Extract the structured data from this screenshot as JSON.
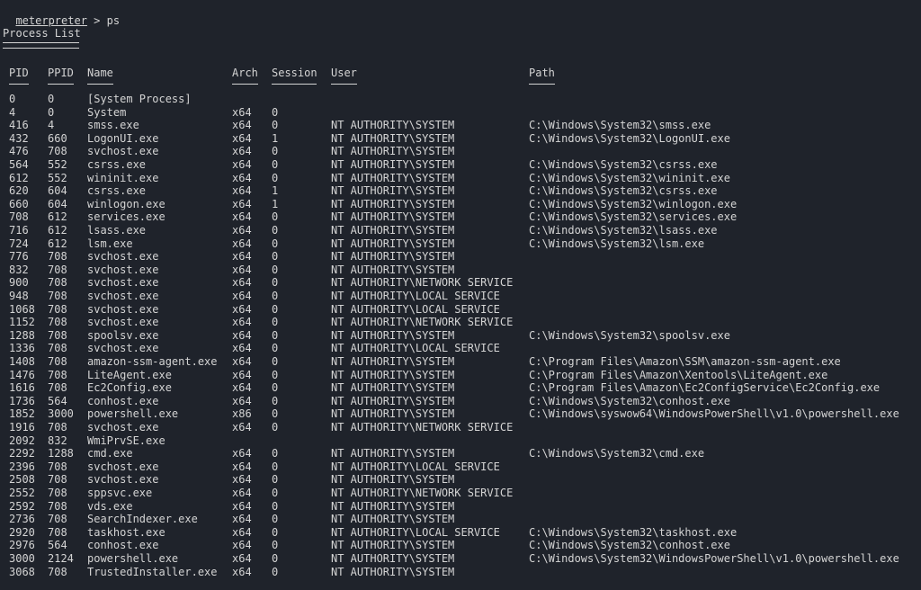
{
  "prompt": {
    "name": "meterpreter",
    "symbol": " > ",
    "command": "ps"
  },
  "title": "Process List",
  "columns": [
    "PID",
    "PPID",
    "Name",
    "Arch",
    "Session",
    "User",
    "Path"
  ],
  "rows": [
    [
      "0",
      "0",
      "[System Process]",
      "",
      "",
      "",
      ""
    ],
    [
      "4",
      "0",
      "System",
      "x64",
      "0",
      "",
      ""
    ],
    [
      "416",
      "4",
      "smss.exe",
      "x64",
      "0",
      "NT AUTHORITY\\SYSTEM",
      "C:\\Windows\\System32\\smss.exe"
    ],
    [
      "432",
      "660",
      "LogonUI.exe",
      "x64",
      "1",
      "NT AUTHORITY\\SYSTEM",
      "C:\\Windows\\System32\\LogonUI.exe"
    ],
    [
      "476",
      "708",
      "svchost.exe",
      "x64",
      "0",
      "NT AUTHORITY\\SYSTEM",
      ""
    ],
    [
      "564",
      "552",
      "csrss.exe",
      "x64",
      "0",
      "NT AUTHORITY\\SYSTEM",
      "C:\\Windows\\System32\\csrss.exe"
    ],
    [
      "612",
      "552",
      "wininit.exe",
      "x64",
      "0",
      "NT AUTHORITY\\SYSTEM",
      "C:\\Windows\\System32\\wininit.exe"
    ],
    [
      "620",
      "604",
      "csrss.exe",
      "x64",
      "1",
      "NT AUTHORITY\\SYSTEM",
      "C:\\Windows\\System32\\csrss.exe"
    ],
    [
      "660",
      "604",
      "winlogon.exe",
      "x64",
      "1",
      "NT AUTHORITY\\SYSTEM",
      "C:\\Windows\\System32\\winlogon.exe"
    ],
    [
      "708",
      "612",
      "services.exe",
      "x64",
      "0",
      "NT AUTHORITY\\SYSTEM",
      "C:\\Windows\\System32\\services.exe"
    ],
    [
      "716",
      "612",
      "lsass.exe",
      "x64",
      "0",
      "NT AUTHORITY\\SYSTEM",
      "C:\\Windows\\System32\\lsass.exe"
    ],
    [
      "724",
      "612",
      "lsm.exe",
      "x64",
      "0",
      "NT AUTHORITY\\SYSTEM",
      "C:\\Windows\\System32\\lsm.exe"
    ],
    [
      "776",
      "708",
      "svchost.exe",
      "x64",
      "0",
      "NT AUTHORITY\\SYSTEM",
      ""
    ],
    [
      "832",
      "708",
      "svchost.exe",
      "x64",
      "0",
      "NT AUTHORITY\\SYSTEM",
      ""
    ],
    [
      "900",
      "708",
      "svchost.exe",
      "x64",
      "0",
      "NT AUTHORITY\\NETWORK SERVICE",
      ""
    ],
    [
      "948",
      "708",
      "svchost.exe",
      "x64",
      "0",
      "NT AUTHORITY\\LOCAL SERVICE",
      ""
    ],
    [
      "1068",
      "708",
      "svchost.exe",
      "x64",
      "0",
      "NT AUTHORITY\\LOCAL SERVICE",
      ""
    ],
    [
      "1152",
      "708",
      "svchost.exe",
      "x64",
      "0",
      "NT AUTHORITY\\NETWORK SERVICE",
      ""
    ],
    [
      "1288",
      "708",
      "spoolsv.exe",
      "x64",
      "0",
      "NT AUTHORITY\\SYSTEM",
      "C:\\Windows\\System32\\spoolsv.exe"
    ],
    [
      "1336",
      "708",
      "svchost.exe",
      "x64",
      "0",
      "NT AUTHORITY\\LOCAL SERVICE",
      ""
    ],
    [
      "1408",
      "708",
      "amazon-ssm-agent.exe",
      "x64",
      "0",
      "NT AUTHORITY\\SYSTEM",
      "C:\\Program Files\\Amazon\\SSM\\amazon-ssm-agent.exe"
    ],
    [
      "1476",
      "708",
      "LiteAgent.exe",
      "x64",
      "0",
      "NT AUTHORITY\\SYSTEM",
      "C:\\Program Files\\Amazon\\Xentools\\LiteAgent.exe"
    ],
    [
      "1616",
      "708",
      "Ec2Config.exe",
      "x64",
      "0",
      "NT AUTHORITY\\SYSTEM",
      "C:\\Program Files\\Amazon\\Ec2ConfigService\\Ec2Config.exe"
    ],
    [
      "1736",
      "564",
      "conhost.exe",
      "x64",
      "0",
      "NT AUTHORITY\\SYSTEM",
      "C:\\Windows\\System32\\conhost.exe"
    ],
    [
      "1852",
      "3000",
      "powershell.exe",
      "x86",
      "0",
      "NT AUTHORITY\\SYSTEM",
      "C:\\Windows\\syswow64\\WindowsPowerShell\\v1.0\\powershell.exe"
    ],
    [
      "1916",
      "708",
      "svchost.exe",
      "x64",
      "0",
      "NT AUTHORITY\\NETWORK SERVICE",
      ""
    ],
    [
      "2092",
      "832",
      "WmiPrvSE.exe",
      "",
      "",
      "",
      ""
    ],
    [
      "2292",
      "1288",
      "cmd.exe",
      "x64",
      "0",
      "NT AUTHORITY\\SYSTEM",
      "C:\\Windows\\System32\\cmd.exe"
    ],
    [
      "2396",
      "708",
      "svchost.exe",
      "x64",
      "0",
      "NT AUTHORITY\\LOCAL SERVICE",
      ""
    ],
    [
      "2508",
      "708",
      "svchost.exe",
      "x64",
      "0",
      "NT AUTHORITY\\SYSTEM",
      ""
    ],
    [
      "2552",
      "708",
      "sppsvc.exe",
      "x64",
      "0",
      "NT AUTHORITY\\NETWORK SERVICE",
      ""
    ],
    [
      "2592",
      "708",
      "vds.exe",
      "x64",
      "0",
      "NT AUTHORITY\\SYSTEM",
      ""
    ],
    [
      "2736",
      "708",
      "SearchIndexer.exe",
      "x64",
      "0",
      "NT AUTHORITY\\SYSTEM",
      ""
    ],
    [
      "2920",
      "708",
      "taskhost.exe",
      "x64",
      "0",
      "NT AUTHORITY\\LOCAL SERVICE",
      "C:\\Windows\\System32\\taskhost.exe"
    ],
    [
      "2976",
      "564",
      "conhost.exe",
      "x64",
      "0",
      "NT AUTHORITY\\SYSTEM",
      "C:\\Windows\\System32\\conhost.exe"
    ],
    [
      "3000",
      "2124",
      "powershell.exe",
      "x64",
      "0",
      "NT AUTHORITY\\SYSTEM",
      "C:\\Windows\\System32\\WindowsPowerShell\\v1.0\\powershell.exe"
    ],
    [
      "3068",
      "708",
      "TrustedInstaller.exe",
      "x64",
      "0",
      "NT AUTHORITY\\SYSTEM",
      ""
    ]
  ]
}
